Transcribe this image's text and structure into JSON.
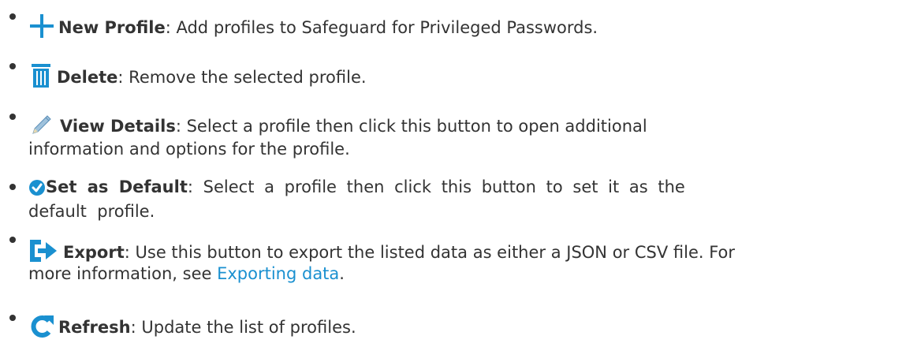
{
  "colors": {
    "text": "#333333",
    "icon_blue": "#1a90d0",
    "link": "#1a90d0"
  },
  "items": [
    {
      "icon": "plus-icon",
      "name": "New Profile",
      "sep": ":",
      "desc": "Add profiles to Safeguard for Privileged Passwords."
    },
    {
      "icon": "trash-icon",
      "name": "Delete",
      "sep": ":",
      "desc": "Remove the selected profile."
    },
    {
      "icon": "pencil-icon",
      "name": "View Details",
      "sep": ":",
      "desc_line1": "Select a profile then click this button to open additional",
      "desc_line2": "information and options for the profile."
    },
    {
      "icon": "check-circle-icon",
      "name": "Set as Default",
      "sep": ":",
      "desc_line1": "Select a profile then click this button to set it as the",
      "desc_line2": "default  profile."
    },
    {
      "icon": "export-icon",
      "name": "Export",
      "sep": ":",
      "desc_line1": "Use this button to export the listed data as either a JSON or CSV file. For",
      "desc_line2_pre": "more information, see ",
      "link": "Exporting data",
      "desc_line2_post": "."
    },
    {
      "icon": "refresh-icon",
      "name": "Refresh",
      "sep": ":",
      "desc": "Update the list of profiles."
    }
  ]
}
